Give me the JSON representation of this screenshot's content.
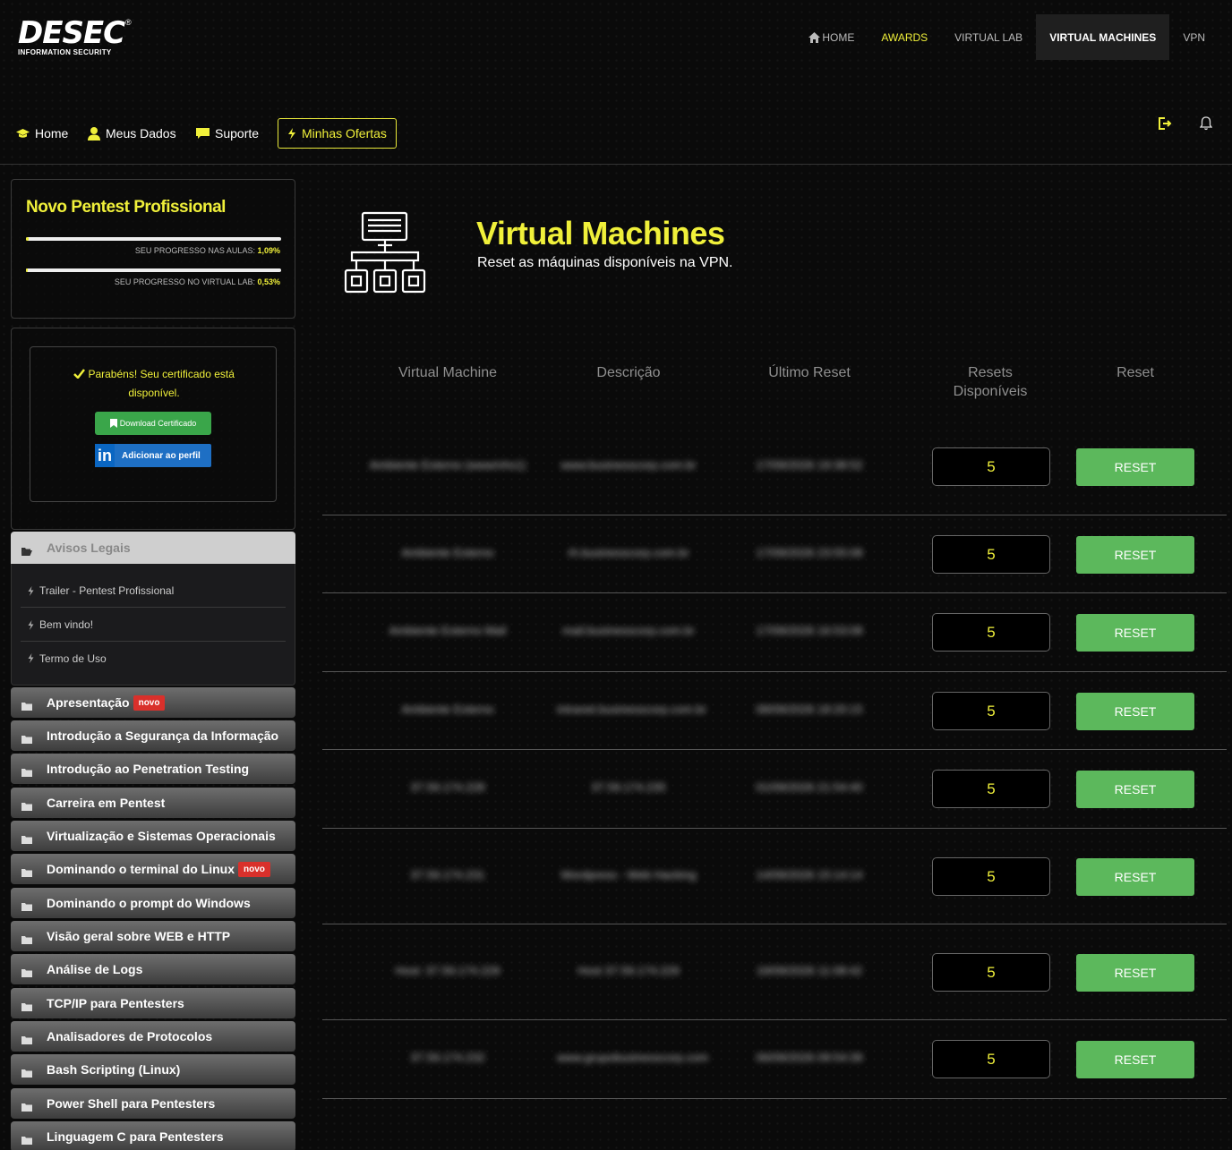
{
  "brand": {
    "name": "DESEC",
    "tagline": "INFORMATION SECURITY",
    "reg": "®"
  },
  "topnav": [
    "HOME",
    "AWARDS",
    "VIRTUAL LAB",
    "VIRTUAL MACHINES",
    "VPN"
  ],
  "subnav": {
    "home": "Home",
    "data": "Meus Dados",
    "support": "Suporte",
    "offers": "Minhas Ofertas"
  },
  "course": {
    "title": "Novo Pentest Profissional",
    "progress_lessons_label": "SEU PROGRESSO NAS AULAS:",
    "progress_lessons": "1,09%",
    "progress_lessons_value": 1.09,
    "progress_lab_label": "SEU PROGRESSO NO VIRTUAL LAB:",
    "progress_lab": "0,53%",
    "progress_lab_value": 0.53
  },
  "certificate": {
    "message_line1": "Parabéns! Seu certificado está",
    "message_line2": "disponível.",
    "download": "Download Certificado",
    "linkedin_logo": "in",
    "linkedin": "Adicionar ao perfil"
  },
  "avisos": {
    "title": "Avisos Legais",
    "items": [
      "Trailer - Pentest Profissional",
      "Bem vindo!",
      "Termo de Uso"
    ]
  },
  "modules": [
    {
      "label": "Apresentação",
      "badge": "novo"
    },
    {
      "label": "Introdução a Segurança da Informação",
      "badge": ""
    },
    {
      "label": "Introdução ao Penetration Testing",
      "badge": ""
    },
    {
      "label": "Carreira em Pentest",
      "badge": ""
    },
    {
      "label": "Virtualização e Sistemas Operacionais",
      "badge": ""
    },
    {
      "label": "Dominando o terminal do Linux",
      "badge": "novo"
    },
    {
      "label": "Dominando o prompt do Windows",
      "badge": ""
    },
    {
      "label": "Visão geral sobre WEB e HTTP",
      "badge": ""
    },
    {
      "label": "Análise de Logs",
      "badge": ""
    },
    {
      "label": "TCP/IP para Pentesters",
      "badge": ""
    },
    {
      "label": "Analisadores de Protocolos",
      "badge": ""
    },
    {
      "label": "Bash Scripting (Linux)",
      "badge": ""
    },
    {
      "label": "Power Shell para Pentesters",
      "badge": ""
    },
    {
      "label": "Linguagem C para Pentesters",
      "badge": ""
    }
  ],
  "page": {
    "title": "Virtual Machines",
    "subtitle": "Reset as máquinas disponíveis na VPN."
  },
  "table": {
    "headers": {
      "vm": "Virtual Machine",
      "desc": "Descrição",
      "last": "Último Reset",
      "avail1": "Resets",
      "avail2": "Disponíveis",
      "reset": "Reset"
    },
    "rows": [
      {
        "vm": "Ambiente Externo (www/vhs1)",
        "desc": "www.businesscorp.com.br",
        "last": "17/09/2026 19:38:52",
        "count": "5",
        "button": "RESET"
      },
      {
        "vm": "Ambiente Externo",
        "desc": "rh.businesscorp.com.br",
        "last": "17/09/2026 23:55:08",
        "count": "5",
        "button": "RESET"
      },
      {
        "vm": "Ambiente Externo Mail",
        "desc": "mail.businesscorp.com.br",
        "last": "17/09/2026 16:53:08",
        "count": "5",
        "button": "RESET"
      },
      {
        "vm": "Ambiente Externo",
        "desc": "intranet.businesscorp.com.br",
        "last": "08/09/2026 18:20:15",
        "count": "5",
        "button": "RESET"
      },
      {
        "vm": "37.59.174.228",
        "desc": "37.59.174.235",
        "last": "01/09/2026 21:54:40",
        "count": "5",
        "button": "RESET"
      },
      {
        "vm": "37.59.174.231",
        "desc": "Wordpress - Web Hacking",
        "last": "14/09/2026 15:14:14",
        "count": "5",
        "button": "RESET"
      },
      {
        "vm": "Host: 37.59.174.229",
        "desc": "Host 37.59.174.229",
        "last": "19/09/2026 11:08:42",
        "count": "5",
        "button": "RESET"
      },
      {
        "vm": "37.59.174.232",
        "desc": "www.grupobusinesscorp.com",
        "last": "06/09/2026 09:54:39",
        "count": "5",
        "button": "RESET"
      }
    ]
  },
  "colors": {
    "accent": "#f0f03a",
    "button": "#5cb85c",
    "badge": "#d9302b"
  }
}
